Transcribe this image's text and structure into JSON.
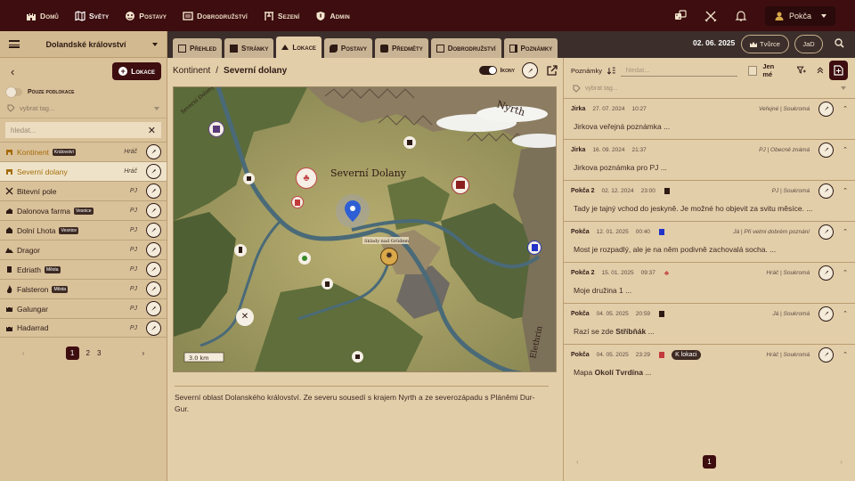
{
  "nav": {
    "items": [
      {
        "label": "Domů",
        "icon": "castle-icon"
      },
      {
        "label": "Světy",
        "icon": "map-icon"
      },
      {
        "label": "Postavy",
        "icon": "mask-icon"
      },
      {
        "label": "Dobrodružství",
        "icon": "scroll-icon"
      },
      {
        "label": "Sezení",
        "icon": "table-icon"
      },
      {
        "label": "Admin",
        "icon": "shield-icon"
      }
    ],
    "user": "Pokča"
  },
  "left": {
    "kingdom": "Dolandské království",
    "add_label": "Lokace",
    "subloc_label": "Pouze podlokace",
    "tag_placeholder": "vybrat tag...",
    "search_placeholder": "hledat...",
    "locations": [
      {
        "name": "Kontinent",
        "badge": "Království",
        "role": "Hráč"
      },
      {
        "name": "Severní dolany",
        "badge": "",
        "role": "Hráč"
      },
      {
        "name": "Bitevní pole",
        "badge": "",
        "role": "PJ"
      },
      {
        "name": "Dalonova farma",
        "badge": "Vesnice",
        "role": "PJ"
      },
      {
        "name": "Dolní Lhota",
        "badge": "Vesnice",
        "role": "PJ"
      },
      {
        "name": "Dragor",
        "badge": "",
        "role": "PJ"
      },
      {
        "name": "Edriath",
        "badge": "Města",
        "role": "PJ"
      },
      {
        "name": "Falsteron",
        "badge": "Města",
        "role": "PJ"
      },
      {
        "name": "Galungar",
        "badge": "",
        "role": "PJ"
      },
      {
        "name": "Hadarrad",
        "badge": "",
        "role": "PJ"
      }
    ],
    "pages": [
      "1",
      "2",
      "3"
    ]
  },
  "tabs": [
    {
      "label": "Přehled"
    },
    {
      "label": "Stránky"
    },
    {
      "label": "Lokace"
    },
    {
      "label": "Postavy"
    },
    {
      "label": "Předměty"
    },
    {
      "label": "Dobrodružství"
    },
    {
      "label": "Poznámky"
    }
  ],
  "header": {
    "date": "02. 06. 2025",
    "creator": "Tvůrce",
    "initials": "JaD"
  },
  "center": {
    "crumb_root": "Kontinent",
    "crumb_sep": "/",
    "crumb_current": "Severní dolany",
    "icons_label": "Ikony",
    "description": "Severní oblast Dolanského království. Ze severu sousedí s krajem Nyrth a ze severozápadu s Pláněmi Dur-Gur."
  },
  "map": {
    "region_label": "Severní Dolany",
    "north_label": "Nyrth",
    "east_label": "Elethrin",
    "west_label": "Severní Dolany",
    "town_label": "Sklady nad Grúdem",
    "scale": "3.0 km"
  },
  "notes": {
    "label": "Poznámky",
    "search_placeholder": "hledat...",
    "only_mine": "Jen mé",
    "tag_placeholder": "vybrat tag...",
    "items": [
      {
        "author": "Jirka",
        "date": "27. 07. 2024",
        "time": "10:27",
        "visibility": "Veřejné | Soukromá",
        "text": "Jirkova veřejná poznámka ...",
        "bold": ""
      },
      {
        "author": "Jirka",
        "date": "16. 09. 2024",
        "time": "21:37",
        "visibility": "PJ | Obecně známá",
        "text": "Jirkova poznámka pro PJ ...",
        "bold": ""
      },
      {
        "author": "Pokča 2",
        "date": "02. 12. 2024",
        "time": "23:00",
        "visibility": "PJ | Soukromá",
        "text": "Tady je tajný vchod do jeskyně. Je možné ho objevit za svitu měsíce. ...",
        "bold": ""
      },
      {
        "author": "Pokča",
        "date": "12. 01. 2025",
        "time": "00:40",
        "visibility": "Já | Při velmi dobrém poznání",
        "text": "Most je rozpadlý, ale je na něm podivně zachovalá socha. ...",
        "bold": ""
      },
      {
        "author": "Pokča 2",
        "date": "15. 01. 2025",
        "time": "09:37",
        "visibility": "Hráč | Soukromá",
        "text": "Moje družina 1 ...",
        "bold": ""
      },
      {
        "author": "Pokča",
        "date": "04. 05. 2025",
        "time": "20:59",
        "visibility": "Já | Soukromá",
        "text": "Razí se zde ",
        "bold": "Stříbňák",
        "tail": " ..."
      },
      {
        "author": "Pokča",
        "date": "04. 05. 2025",
        "time": "23:29",
        "visibility": "Hráč | Soukromá",
        "text": "Mapa ",
        "bold": "Okolí Tvrdína",
        "tail": " ...",
        "tag": "K lokaci"
      }
    ],
    "page": "1"
  }
}
